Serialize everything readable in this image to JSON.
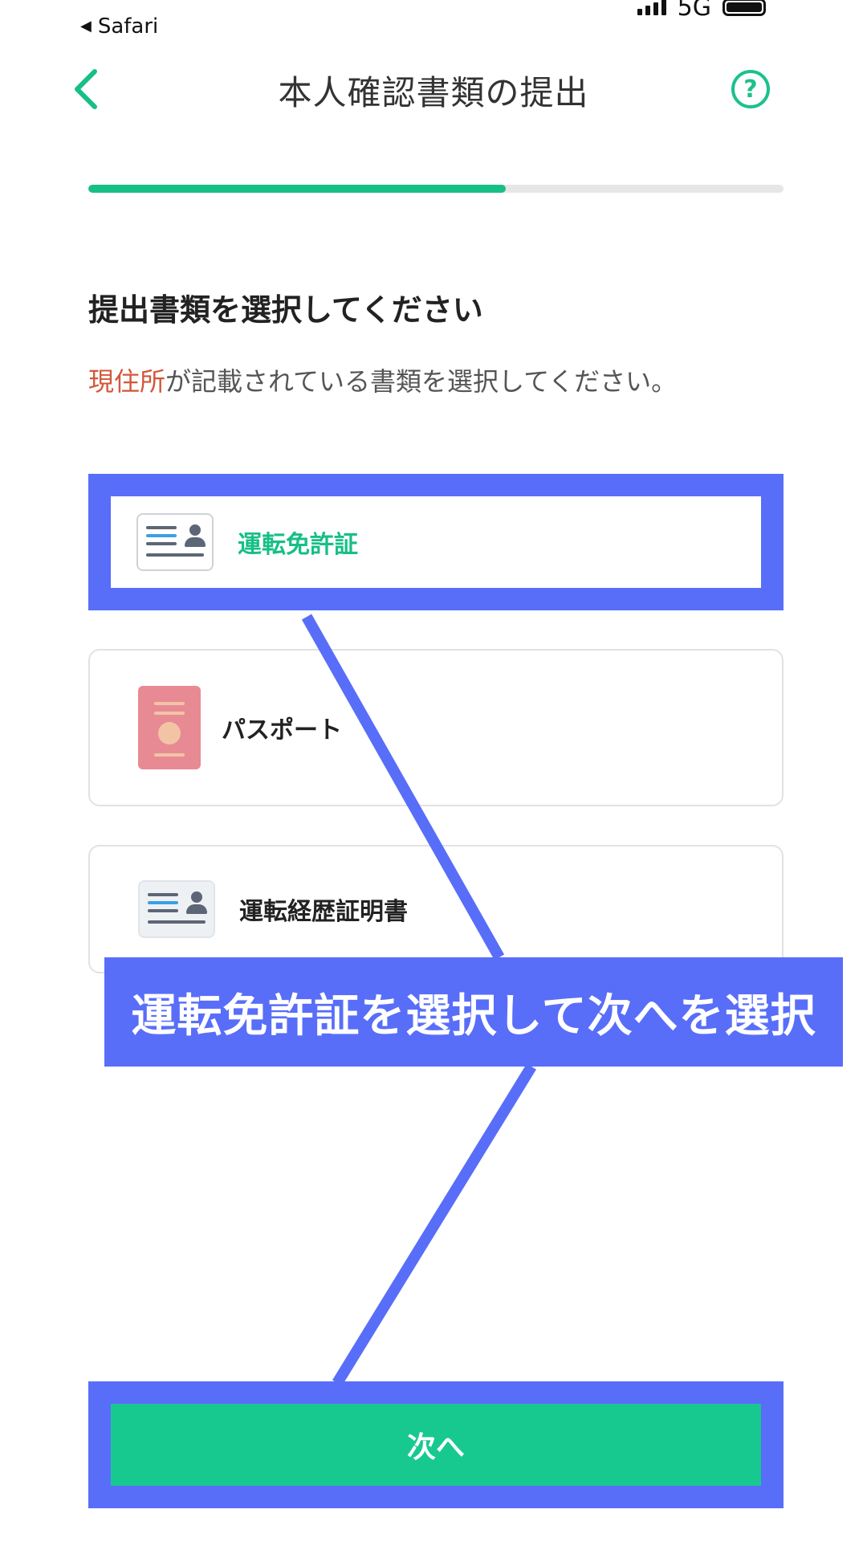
{
  "status_bar": {
    "back_app": "Safari",
    "network": "5G"
  },
  "header": {
    "title": "本人確認書類の提出",
    "help_symbol": "?"
  },
  "progress": {
    "fraction": 0.6
  },
  "content": {
    "heading": "提出書類を選択してください",
    "subtext_accent": "現住所",
    "subtext_rest": "が記載されている書類を選択してください。"
  },
  "options": [
    {
      "label": "運転免許証",
      "icon": "id-card-icon",
      "selected": true
    },
    {
      "label": "パスポート",
      "icon": "passport-icon",
      "selected": false
    },
    {
      "label": "運転経歴証明書",
      "icon": "id-card-icon",
      "selected": false
    }
  ],
  "annotation": {
    "callout": "運転免許証を選択して次へを選択"
  },
  "footer": {
    "next_label": "次へ"
  },
  "colors": {
    "accent_green": "#17bf86",
    "button_green": "#18c98f",
    "annotation_blue": "#586ef9",
    "accent_red": "#d2573a"
  }
}
